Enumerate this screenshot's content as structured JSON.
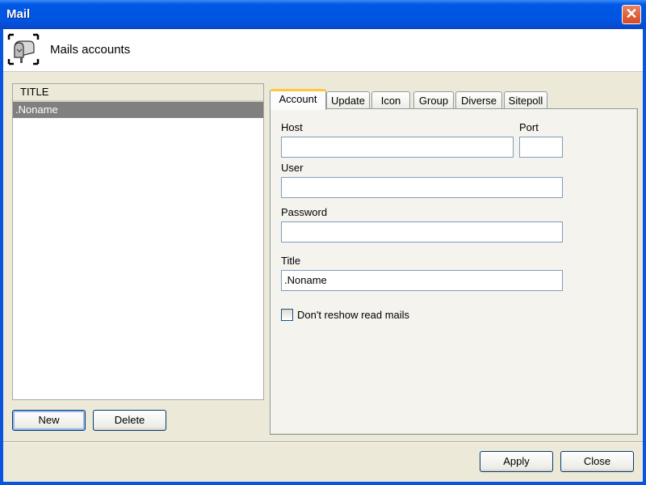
{
  "window": {
    "title": "Mail",
    "close_icon": "close-x-icon"
  },
  "header": {
    "icon": "mailbox-icon",
    "subtitle": "Mails accounts"
  },
  "account_list": {
    "column_header": "TITLE",
    "items": [
      {
        "label": ".Noname",
        "selected": true
      }
    ]
  },
  "list_buttons": {
    "new_label": "New",
    "delete_label": "Delete"
  },
  "tabs": [
    {
      "label": "Account",
      "active": true
    },
    {
      "label": "Update",
      "active": false
    },
    {
      "label": "Icon",
      "active": false
    },
    {
      "label": "Group",
      "active": false
    },
    {
      "label": "Diverse",
      "active": false
    },
    {
      "label": "Sitepoll",
      "active": false
    }
  ],
  "account_form": {
    "host_label": "Host",
    "host_value": "",
    "port_label": "Port",
    "port_value": "",
    "user_label": "User",
    "user_value": "",
    "password_label": "Password",
    "password_value": "",
    "title_label": "Title",
    "title_value": ".Noname",
    "dont_reshow_label": "Don't reshow read mails",
    "dont_reshow_checked": false
  },
  "footer": {
    "apply_label": "Apply",
    "close_label": "Close"
  },
  "colors": {
    "titlebar": "#0055e0",
    "selection": "#808080",
    "active_tab_accent": "#ffc83c",
    "close_button": "#d54a24"
  }
}
